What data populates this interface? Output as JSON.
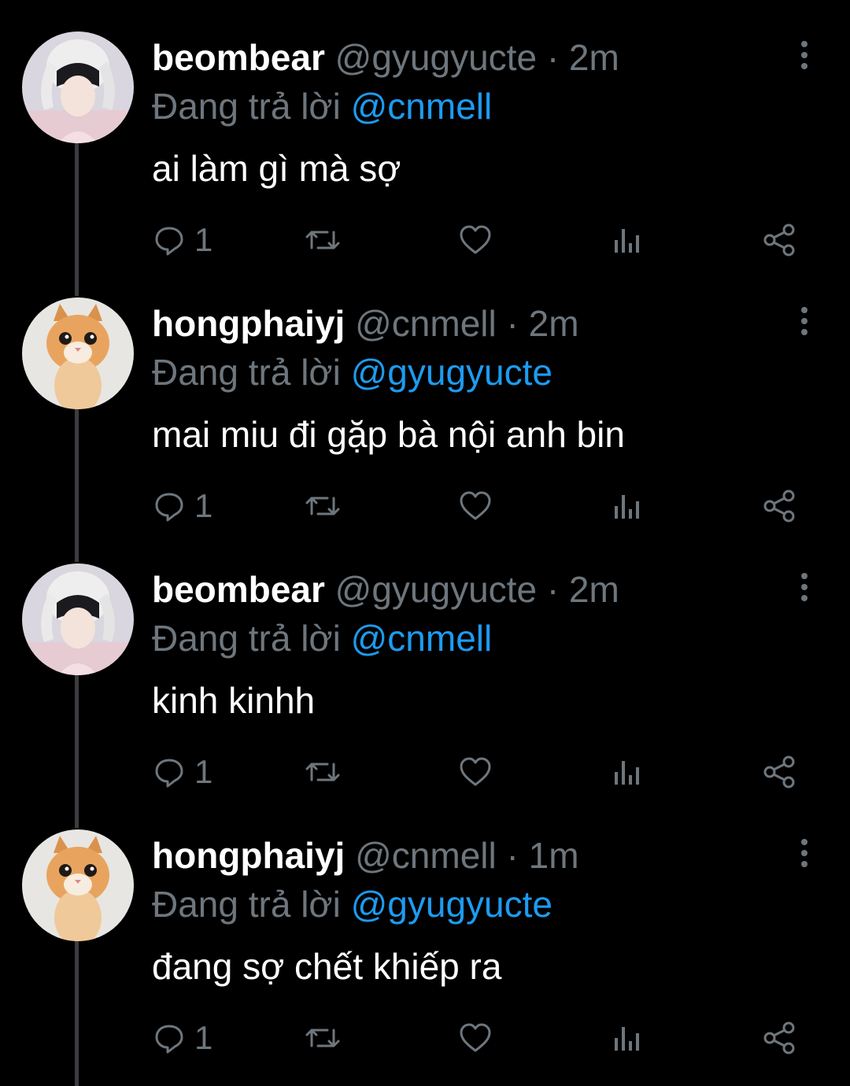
{
  "colors": {
    "background": "#000000",
    "text_primary": "#ffffff",
    "text_secondary": "#6e767d",
    "mention": "#1d9bf0",
    "thread_line": "#3a3d40"
  },
  "tweets": [
    {
      "display_name": "beombear",
      "handle": "@gyugyucte",
      "time": "· 2m",
      "reply_label": "Đang trả lời",
      "reply_to": "@cnmell",
      "text": "ai làm gì mà sợ",
      "reply_count": "1",
      "avatar": "person-avatar-icon"
    },
    {
      "display_name": "hongphaiyj",
      "handle": "@cnmell",
      "time": "· 2m",
      "reply_label": "Đang trả lời",
      "reply_to": "@gyugyucte",
      "text": "mai miu đi gặp bà nội anh bin",
      "reply_count": "1",
      "avatar": "cat-avatar-icon"
    },
    {
      "display_name": "beombear",
      "handle": "@gyugyucte",
      "time": "· 2m",
      "reply_label": "Đang trả lời",
      "reply_to": "@cnmell",
      "text": "kinh kinhh",
      "reply_count": "1",
      "avatar": "person-avatar-icon"
    },
    {
      "display_name": "hongphaiyj",
      "handle": "@cnmell",
      "time": "· 1m",
      "reply_label": "Đang trả lời",
      "reply_to": "@gyugyucte",
      "text": "đang sợ chết khiếp ra",
      "reply_count": "1",
      "avatar": "cat-avatar-icon"
    }
  ],
  "icons": {
    "reply": "speech-bubble-icon",
    "retweet": "retweet-icon",
    "like": "heart-icon",
    "analytics": "bar-chart-icon",
    "share": "share-icon",
    "more": "more-vertical-icon"
  }
}
